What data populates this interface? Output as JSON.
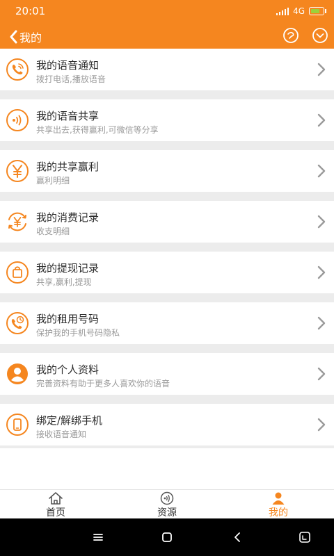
{
  "status_bar": {
    "time": "20:01",
    "network": "4G"
  },
  "header": {
    "title": "我的"
  },
  "items": [
    {
      "title": "我的语音通知",
      "subtitle": "拨打电话,播放语音",
      "icon": "phone-icon"
    },
    {
      "title": "我的语音共享",
      "subtitle": "共享出去,获得赢利,可微信等分享",
      "icon": "sound-waves-icon"
    },
    {
      "title": "我的共享赢利",
      "subtitle": "赢利明细",
      "icon": "yen-icon"
    },
    {
      "title": "我的消费记录",
      "subtitle": "收支明细",
      "icon": "yen-exchange-icon"
    },
    {
      "title": "我的提现记录",
      "subtitle": "共享,赢利,提现",
      "icon": "shopping-bag-icon"
    },
    {
      "title": "我的租用号码",
      "subtitle": "保护我的手机号码隐私",
      "icon": "phone-clock-icon"
    },
    {
      "title": "我的个人资料",
      "subtitle": "完善资料有助于更多人喜欢你的语音",
      "icon": "person-icon"
    },
    {
      "title": "绑定/解绑手机",
      "subtitle": "接收语音通知",
      "icon": "mobile-phone-icon"
    }
  ],
  "tabs": [
    {
      "label": "首页",
      "icon": "home-icon",
      "active": false
    },
    {
      "label": "资源",
      "icon": "sound-waves-icon",
      "active": false
    },
    {
      "label": "我的",
      "icon": "person-icon",
      "active": true
    }
  ],
  "colors": {
    "accent": "#f5861f",
    "background": "#ececec",
    "title_text": "#2c2c2c",
    "subtitle_text": "#9a9a9a"
  }
}
